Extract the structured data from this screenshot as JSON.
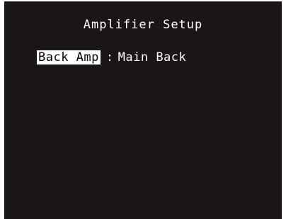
{
  "screen": {
    "title": "Amplifier Setup",
    "setting": {
      "label": "Back Amp",
      "separator": ":",
      "value": "Main Back"
    }
  },
  "colors": {
    "background": "#1a1616",
    "text": "#ffffff",
    "highlight_bg": "#ffffff",
    "highlight_text": "#000000"
  }
}
